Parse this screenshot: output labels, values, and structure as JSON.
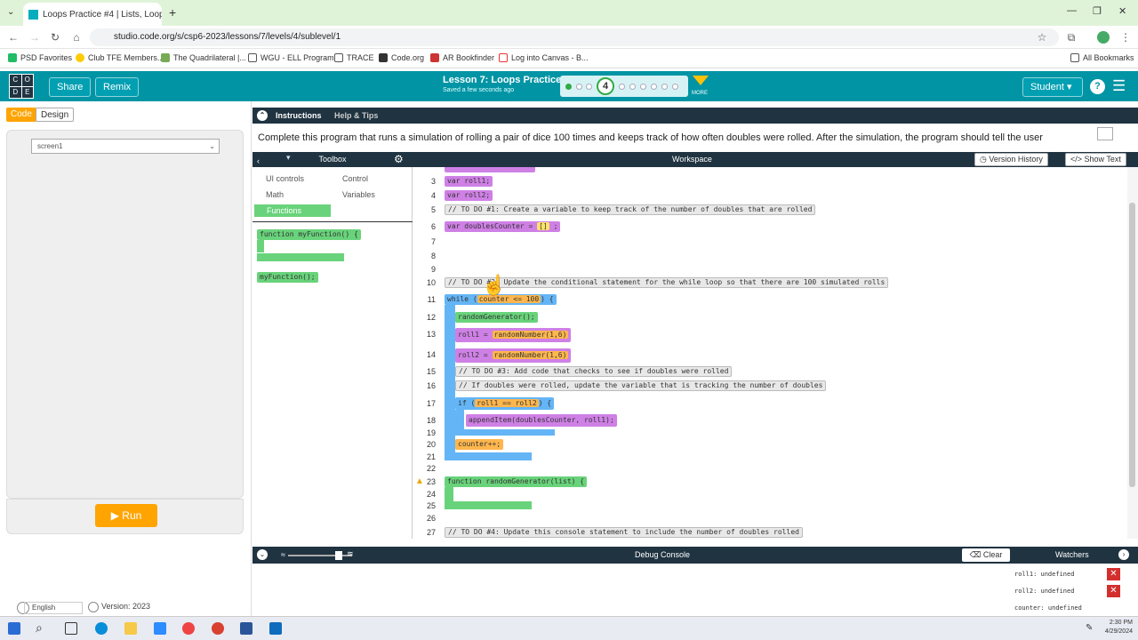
{
  "browser": {
    "tab_title": "Loops Practice #4 | Lists, Loops,",
    "url": "studio.code.org/s/csp6-2023/lessons/7/levels/4/sublevel/1",
    "bookmarks": [
      "PSD Favorites",
      "Club TFE Members...",
      "The Quadrilateral |...",
      "WGU - ELL Program",
      "TRACE",
      "Code.org",
      "AR Bookfinder",
      "Log into Canvas - B..."
    ],
    "all_bookmarks": "All Bookmarks"
  },
  "header": {
    "logo_letters": [
      "C",
      "O",
      "D",
      "E"
    ],
    "share": "Share",
    "remix": "Remix",
    "lesson_title": "Lesson 7: Loops Practice",
    "saved": "Saved a few seconds ago",
    "level": "4",
    "more": "MORE",
    "user": "Student",
    "help": "?"
  },
  "left": {
    "code_tab": "Code",
    "design_tab": "Design",
    "screen": "screen1",
    "run": "Run",
    "language": "English",
    "version": "Version: 2023"
  },
  "instructions": {
    "tab1": "Instructions",
    "tab2": "Help & Tips",
    "text": "Complete this program that runs a simulation of rolling a pair of dice 100 times and keeps track of how often doubles were rolled. After the simulation, the program should tell the user"
  },
  "toolbox": {
    "title": "Toolbox",
    "categories": {
      "ui": "UI controls",
      "control": "Control",
      "math": "Math",
      "variables": "Variables",
      "functions": "Functions"
    },
    "blocks": {
      "fn_def": "function myFunction() {",
      "fn_call": "myFunction();"
    }
  },
  "workspace": {
    "title": "Workspace",
    "version_history": "Version History",
    "show_text": "Show Text",
    "lines": [
      "3",
      "4",
      "5",
      "6",
      "7",
      "8",
      "9",
      "10",
      "11",
      "12",
      "13",
      "14",
      "15",
      "16",
      "17",
      "18",
      "19",
      "20",
      "21",
      "22",
      "23",
      "24",
      "25",
      "26",
      "27"
    ],
    "code": {
      "l3": "var roll1;",
      "l4": "var roll2;",
      "l5": "// TO DO #1: Create a variable to keep track of the number of doubles that are rolled",
      "l6a": "var doublesCounter =",
      "l6b": "[]",
      "l10": "// TO DO #2: Update the conditional statement for the while loop so that there are 100 simulated rolls",
      "l11a": "while (",
      "l11b": "counter <= 100",
      "l11c": ") {",
      "l12": "randomGenerator();",
      "l13a": "roll1 =",
      "l13b": "randomNumber(1,6)",
      "l14a": "roll2 =",
      "l14b": "randomNumber(1,6)",
      "l15": "// TO DO #3: Add code that checks to see if doubles were rolled",
      "l16": "// If doubles were rolled, update the variable that is tracking the number of doubles",
      "l17a": "if (",
      "l17b": "roll1 == roll2",
      "l17c": ") {",
      "l18": "appendItem(doublesCounter, roll1);",
      "l20": "counter++;",
      "l23": "function randomGenerator(list) {",
      "l27": "// TO DO #4: Update this console statement to include the number of doubles rolled"
    }
  },
  "debug": {
    "title": "Debug Console",
    "clear": "Clear",
    "watchers": "Watchers",
    "watches": [
      "roll1: undefined",
      "roll2: undefined",
      "counter: undefined"
    ]
  },
  "taskbar": {
    "time": "2:30 PM",
    "date": "4/29/2024"
  },
  "colors": {
    "teal": "#0094a5",
    "dark": "#1f3340",
    "run": "#ffa400",
    "purple": "#cf80e5",
    "blue": "#64b5f6",
    "green": "#68d37a",
    "orange": "#ffb74d"
  }
}
